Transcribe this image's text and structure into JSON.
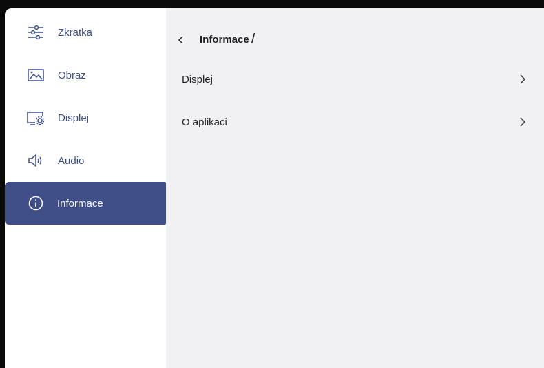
{
  "sidebar": {
    "items": [
      {
        "label": "Zkratka",
        "icon": "sliders-icon"
      },
      {
        "label": "Obraz",
        "icon": "image-icon"
      },
      {
        "label": "Displej",
        "icon": "display-settings-icon"
      },
      {
        "label": "Audio",
        "icon": "speaker-icon"
      },
      {
        "label": "Informace",
        "icon": "info-icon",
        "active": true
      }
    ]
  },
  "header": {
    "title": "Informace",
    "separator": "/"
  },
  "main": {
    "rows": [
      {
        "label": "Displej"
      },
      {
        "label": "O aplikaci"
      }
    ]
  },
  "colors": {
    "accent": "#3f4e87",
    "nav_text": "#3d4f8a",
    "content_bg": "#f1f1f3",
    "sidebar_bg": "#ffffff"
  }
}
